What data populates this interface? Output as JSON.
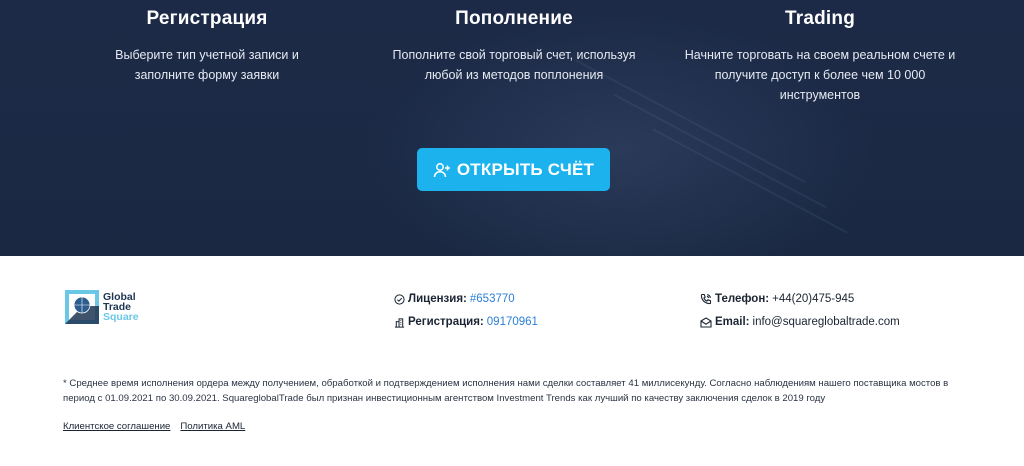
{
  "steps": [
    {
      "title": "Регистрация",
      "text": "Выберите тип учетной записи и заполните форму заявки"
    },
    {
      "title": "Пополнение",
      "text": "Пополните свой торговый счет, используя любой из методов поплонения"
    },
    {
      "title": "Trading",
      "text": "Начните торговать на своем реальном счете и получите доступ к более чем 10 000 инструментов"
    }
  ],
  "cta": {
    "label": "ОТКРЫТЬ СЧЁТ",
    "icon": "user-plus-icon"
  },
  "logo": {
    "line1": "Global",
    "line2": "Trade",
    "line3": "Square"
  },
  "info": {
    "license": {
      "label": "Лицензия:",
      "value": "#653770",
      "icon": "check-circle-icon"
    },
    "registration": {
      "label": "Регистрация:",
      "value": "09170961",
      "icon": "building-icon"
    },
    "phone": {
      "label": "Телефон:",
      "value": "+44(20)475-945",
      "icon": "phone-icon"
    },
    "email": {
      "label": "Email:",
      "value": "info@squareglobaltrade.com",
      "icon": "envelope-icon"
    }
  },
  "disclaimer": "* Среднее время исполнения ордера между получением, обработкой и подтверждением исполнения нами сделки составляет 41 миллисекунду. Согласно наблюдениям нашего поставщика мостов в период с 01.09.2021 по 30.09.2021. SquareglobalTrade был признан инвестиционным агентством Investment Trends как лучший по качеству заключения сделок в 2019 году",
  "links": [
    "Клиентское соглашение",
    "Политика AML"
  ],
  "colors": {
    "hero_bg": "#1c2a47",
    "cta_bg": "#1bb2ee",
    "link": "#2c7fd4",
    "logo_dark": "#1e3552",
    "logo_light": "#6bc7e6"
  }
}
